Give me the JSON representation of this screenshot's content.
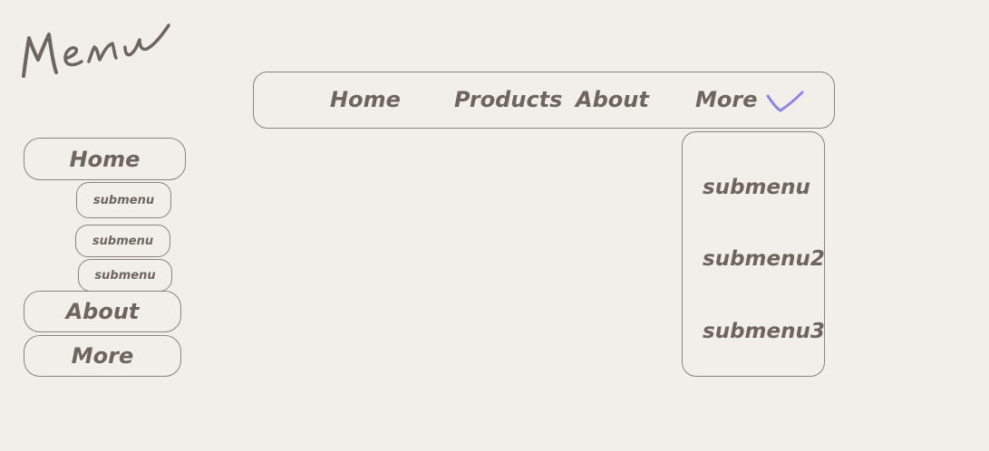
{
  "title": "Menu",
  "topnav": {
    "items": [
      "Home",
      "Products",
      "About",
      "More"
    ],
    "chevron_color": "#8a87e6"
  },
  "dropdown": {
    "items": [
      "submenu",
      "submenu2",
      "submenu3"
    ]
  },
  "sidebar": {
    "home": "Home",
    "submenus": [
      "submenu",
      "submenu",
      "submenu"
    ],
    "about": "About",
    "more": "More"
  }
}
